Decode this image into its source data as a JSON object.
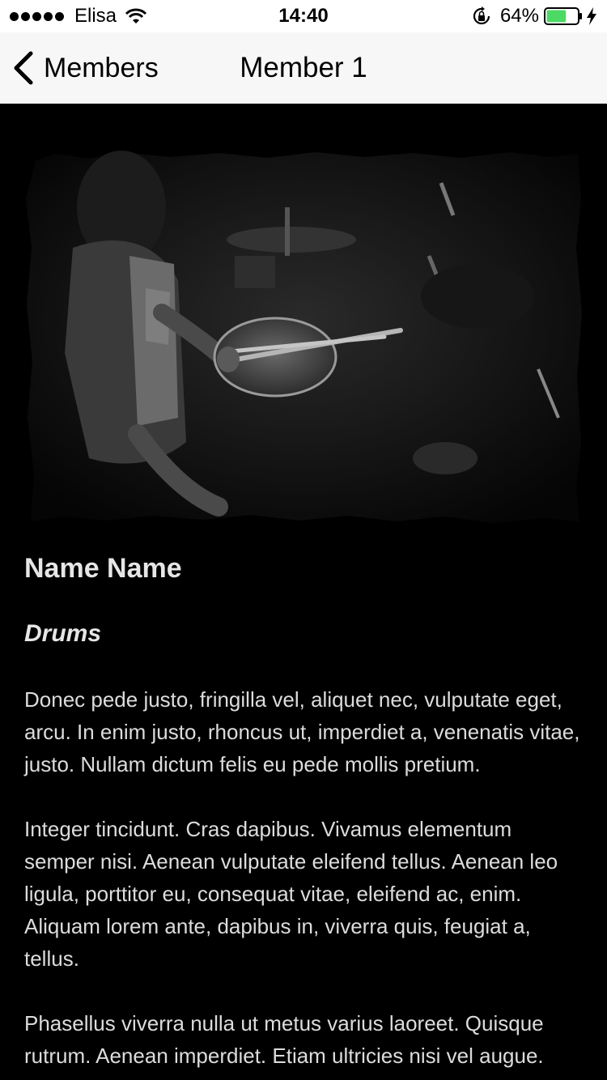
{
  "status_bar": {
    "carrier": "Elisa",
    "time": "14:40",
    "battery_percent": "64%",
    "battery_level": 0.64,
    "battery_color": "#4cd964",
    "icons": [
      "signal-dots",
      "wifi-icon",
      "orientation-lock-icon",
      "battery-icon",
      "charging-bolt-icon"
    ]
  },
  "nav": {
    "back_label": "Members",
    "title": "Member 1",
    "back_icon": "chevron-left-icon"
  },
  "member": {
    "photo": "drummer-photo",
    "name": "Name Name",
    "role": "Drums",
    "bio": [
      "Donec pede justo, fringilla vel, aliquet nec, vulputate eget, arcu. In enim justo, rhoncus ut, imperdiet a, venenatis vitae, justo. Nullam dictum felis eu pede mollis pretium.",
      "Integer tincidunt. Cras dapibus. Vivamus elementum semper nisi. Aenean vulputate eleifend tellus. Aenean leo ligula, porttitor eu, consequat vitae, eleifend ac, enim. Aliquam lorem ante, dapibus in, viverra quis, feugiat a, tellus.",
      "Phasellus viverra nulla ut metus varius laoreet. Quisque rutrum. Aenean imperdiet. Etiam ultricies nisi vel augue."
    ]
  },
  "colors": {
    "background": "#000000",
    "nav_background": "#f7f7f7",
    "text": "#e6e6e6"
  }
}
